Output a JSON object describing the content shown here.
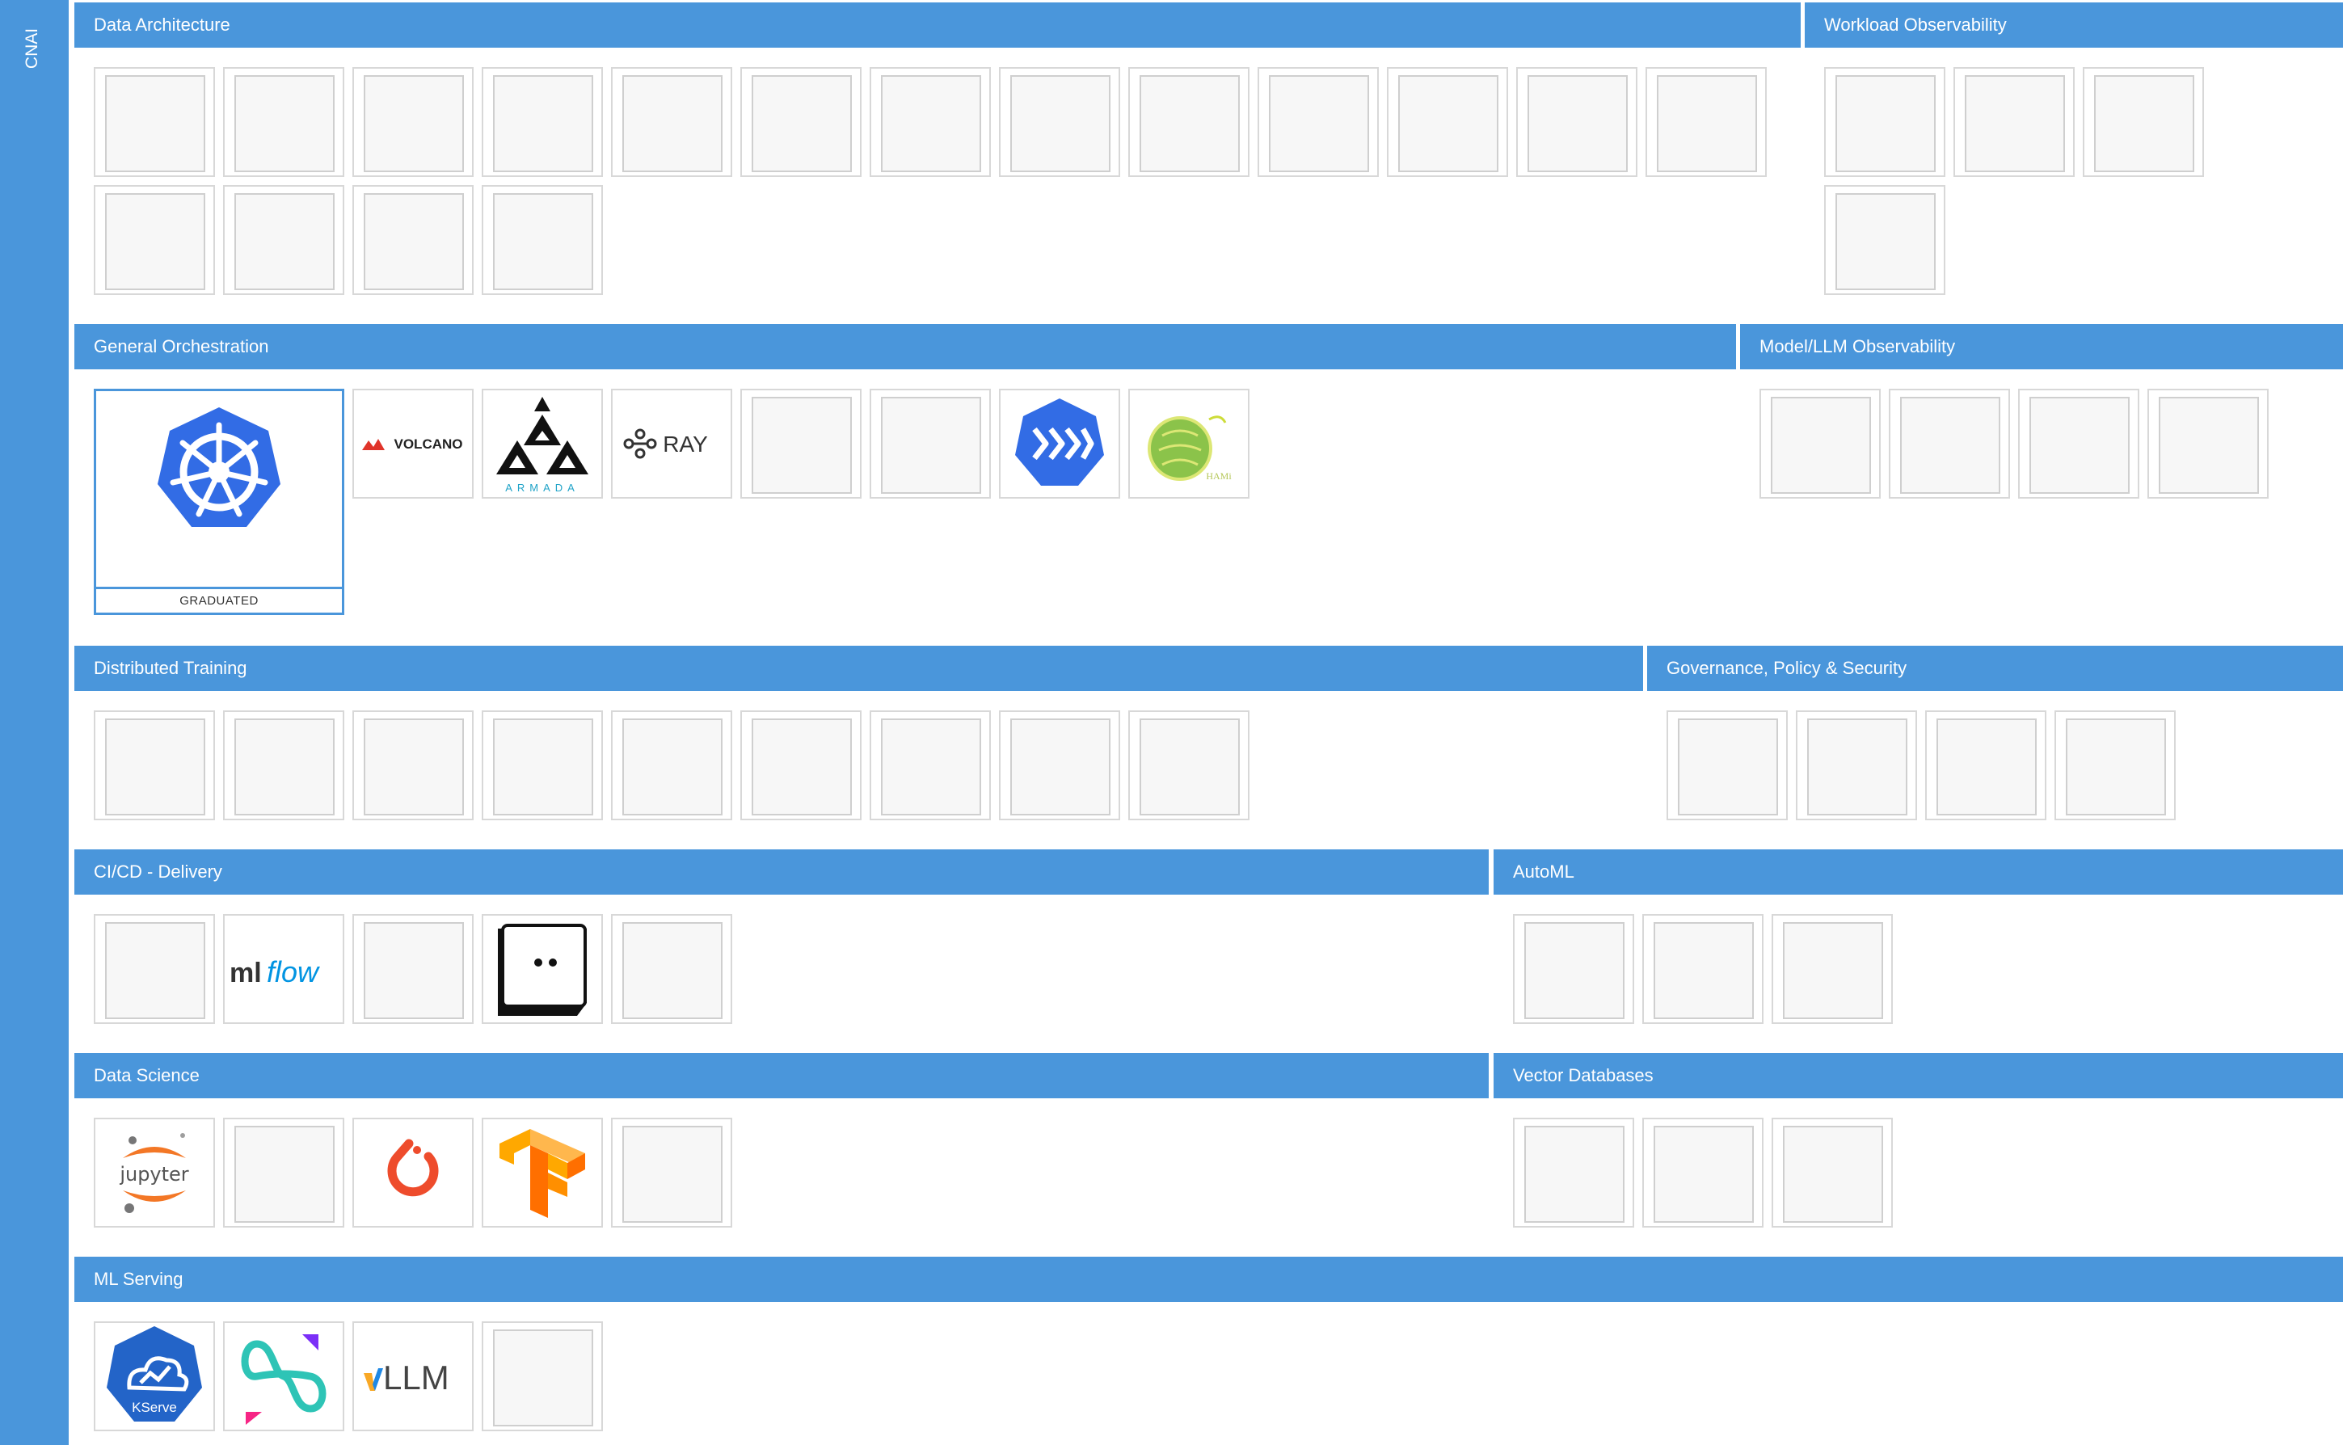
{
  "sidebar": {
    "label": "CNAI"
  },
  "sections": {
    "data_architecture": "Data Architecture",
    "workload_observability": "Workload Observability",
    "general_orchestration": "General Orchestration",
    "model_llm_observability": "Model/LLM Observability",
    "distributed_training": "Distributed Training",
    "governance": "Governance, Policy & Security",
    "cicd": "CI/CD - Delivery",
    "automl": "AutoML",
    "data_science": "Data Science",
    "vector_databases": "Vector Databases",
    "ml_serving": "ML Serving"
  },
  "badges": {
    "graduated": "GRADUATED"
  },
  "logos": {
    "volcano": "VOLCANO",
    "armada": "ARMADA",
    "ray": "RAY",
    "hami": "HAMi",
    "mlflow_ml": "ml",
    "mlflow_flow": "flow",
    "jupyter": "jupyter",
    "kserve": "KServe",
    "vllm_v": "v",
    "vllm_llm": "LLM"
  },
  "colors": {
    "accent": "#4a96db",
    "kubernetes": "#326ce5",
    "tensorflow": "#f9a825",
    "jupyter_orange": "#f37726",
    "mlflow_blue": "#0194e2"
  }
}
